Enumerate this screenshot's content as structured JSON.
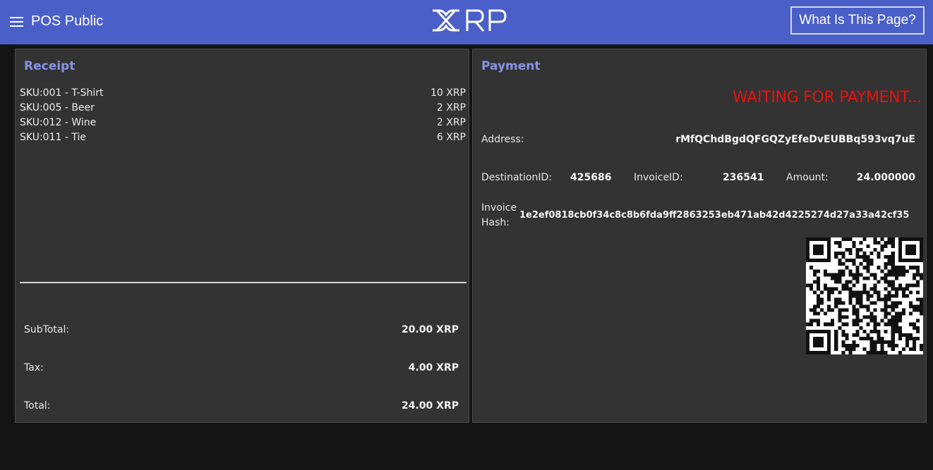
{
  "header": {
    "menu_icon": "hamburger-menu-icon",
    "app_title": "POS Public",
    "logo_text": "XRP",
    "help_button": "What Is This Page?"
  },
  "receipt": {
    "heading": "Receipt",
    "items": [
      {
        "name": "SKU:001 - T-Shirt",
        "price": "10 XRP"
      },
      {
        "name": "SKU:005 - Beer",
        "price": "2 XRP"
      },
      {
        "name": "SKU:012 - Wine",
        "price": "2 XRP"
      },
      {
        "name": "SKU:011 - Tie",
        "price": "6 XRP"
      }
    ],
    "subtotal_label": "SubTotal:",
    "subtotal_value": "20.00 XRP",
    "tax_label": "Tax:",
    "tax_value": "4.00 XRP",
    "total_label": "Total:",
    "total_value": "24.00 XRP"
  },
  "payment": {
    "heading": "Payment",
    "status": "WAITING FOR PAYMENT...",
    "status_color": "#e8130f",
    "address_label": "Address:",
    "address_value": "rMfQChdBgdQFGQZyEfeDvEUBBq593vq7uE",
    "destination_label": "DestinationID:",
    "destination_value": "425686",
    "invoice_label": "InvoiceID:",
    "invoice_value": "236541",
    "amount_label": "Amount:",
    "amount_value": "24.000000",
    "hash_label_line1": "Invoice",
    "hash_label_line2": "Hash:",
    "hash_value": "1e2ef0818cb0f34c8c8b6fda9ff2863253eb471ab42d4225274d27a33a42cf35",
    "qr_icon": "qr-code"
  },
  "colors": {
    "topbar": "#4a5fc8",
    "heading": "#8794e6",
    "panel": "#333333",
    "background": "#141414"
  }
}
